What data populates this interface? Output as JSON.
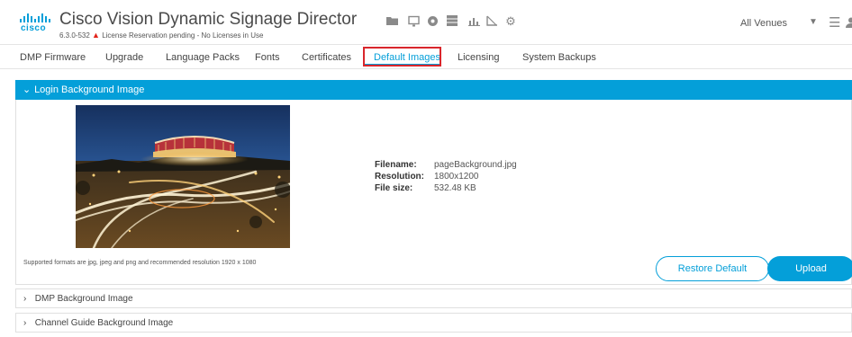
{
  "header": {
    "logo_text": "cisco",
    "title": "Cisco Vision Dynamic Signage Director",
    "subtitle_version": "6.3.0-532",
    "subtitle_warning": "License Reservation pending - No Licenses in Use",
    "icons": [
      "folder-icon",
      "monitor-icon",
      "record-icon",
      "grid-icon",
      "bar-chart-icon",
      "ruler-icon",
      "gear-icon"
    ],
    "venue_label": "All Venues"
  },
  "tabs": [
    {
      "label": "DMP Firmware"
    },
    {
      "label": "Upgrade"
    },
    {
      "label": "Language Packs"
    },
    {
      "label": "Fonts"
    },
    {
      "label": "Certificates"
    },
    {
      "label": "Default Images",
      "active": true
    },
    {
      "label": "Licensing"
    },
    {
      "label": "System Backups"
    }
  ],
  "login_panel": {
    "title": "Login Background Image",
    "filename_label": "Filename:",
    "filename": "pageBackground.jpg",
    "resolution_label": "Resolution:",
    "resolution": "1800x1200",
    "filesize_label": "File size:",
    "filesize": "532.48 KB",
    "formats_note": "Supported formats are jpg, jpeg and png and recommended resolution 1920 x 1080",
    "restore_label": "Restore Default",
    "upload_label": "Upload"
  },
  "collapsed_panels": [
    {
      "title": "DMP Background Image"
    },
    {
      "title": "Channel Guide Background Image"
    }
  ],
  "colors": {
    "accent": "#049fd9",
    "highlight_box": "#d9262c",
    "warning": "#e2231a"
  }
}
